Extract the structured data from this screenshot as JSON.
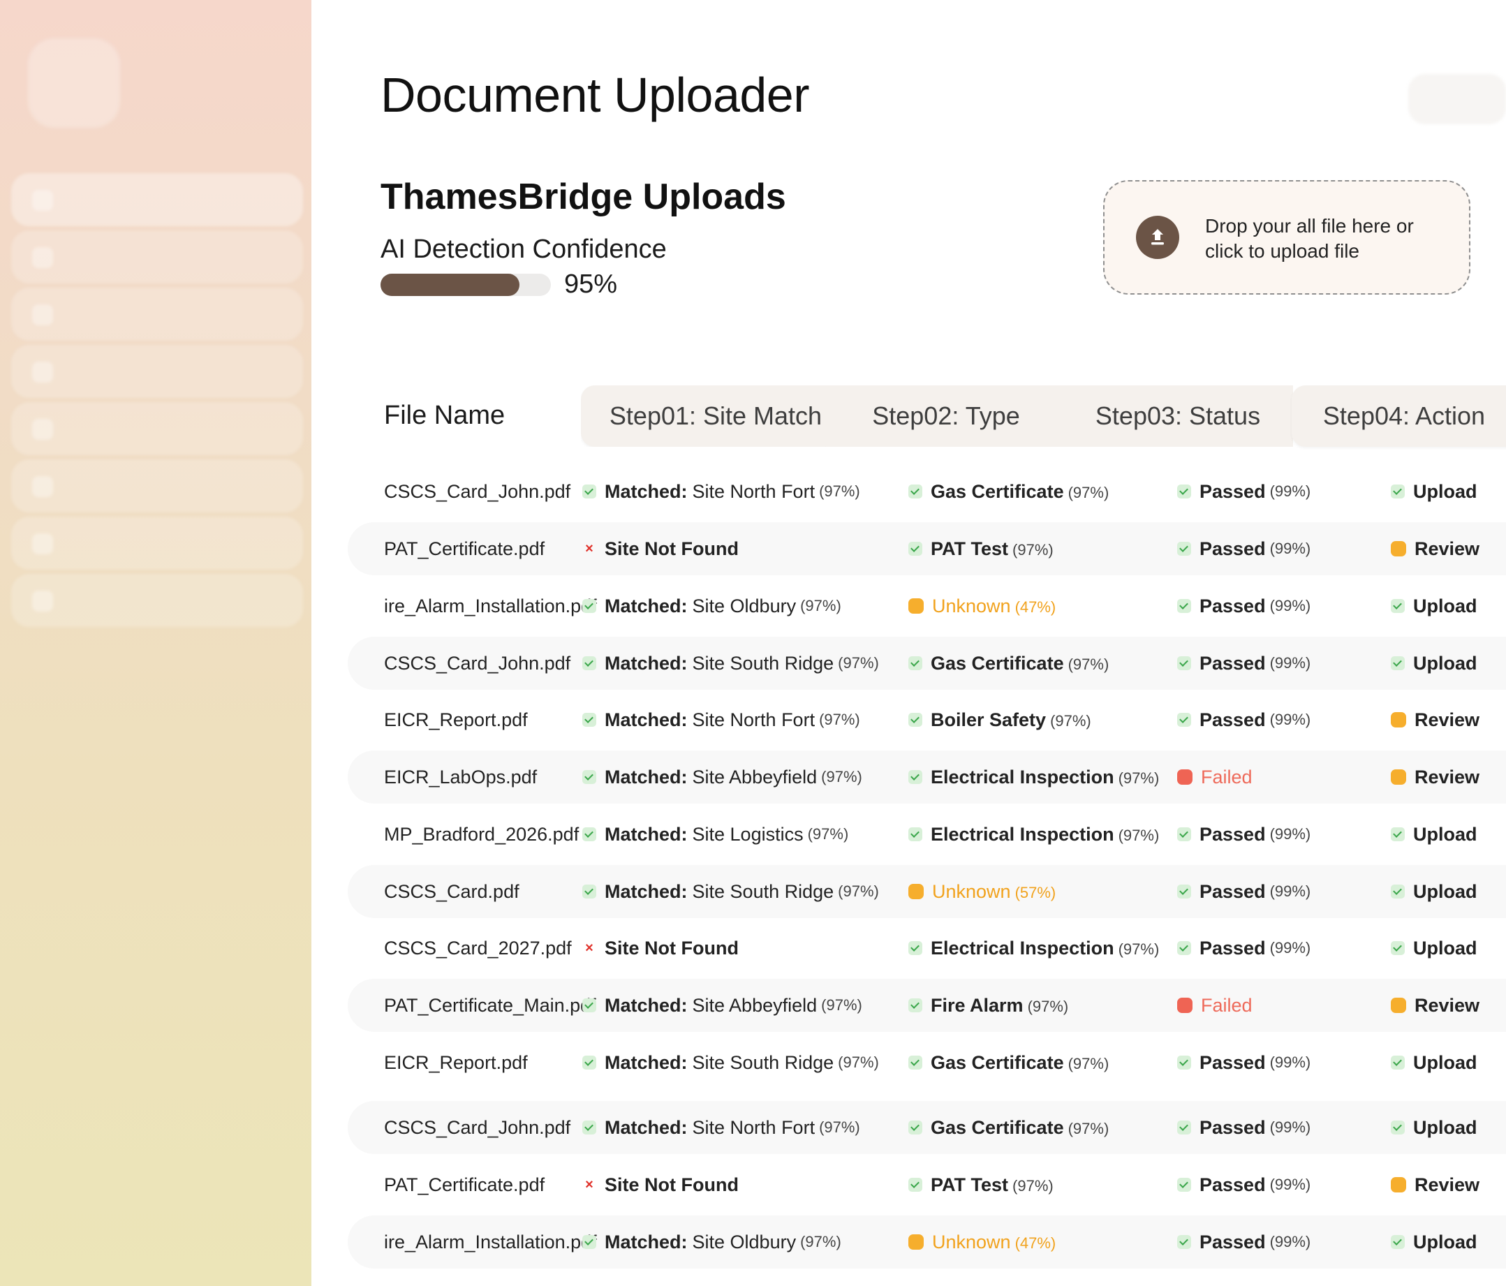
{
  "page_title": "Document Uploader",
  "section_title": "ThamesBridge Uploads",
  "confidence": {
    "label": "AI Detection Confidence",
    "value_text": "95%",
    "value": 0.95
  },
  "dropzone": {
    "line1": "Drop your all file here or",
    "line2": "click to upload file",
    "icon": "upload-icon"
  },
  "table": {
    "file_header": "File Name",
    "steps": [
      "Step01: Site Match",
      "Step02: Type",
      "Step03:  Status",
      "Step04: Action"
    ],
    "rows": [
      {
        "file": "CSCS_Card_John.pdf",
        "site_state": "ok",
        "site_prefix": "Matched:",
        "site": "Site North Fort",
        "site_pct": "(97%)",
        "type_state": "ok",
        "type": "Gas Certificate",
        "type_pct": "(97%)",
        "status_state": "ok",
        "status": "Passed",
        "status_pct": "(99%)",
        "action_state": "ok",
        "action": "Upload"
      },
      {
        "file": "PAT_Certificate.pdf",
        "site_state": "x",
        "site_prefix": "",
        "site": "Site Not Found",
        "site_pct": "",
        "type_state": "ok",
        "type": "PAT Test",
        "type_pct": "(97%)",
        "status_state": "ok",
        "status": "Passed",
        "status_pct": "(99%)",
        "action_state": "warn",
        "action": "Review"
      },
      {
        "file": "ire_Alarm_Installation.pdf",
        "site_state": "ok",
        "site_prefix": "Matched:",
        "site": "Site Oldbury",
        "site_pct": "(97%)",
        "type_state": "warn",
        "type": "Unknown",
        "type_pct": "(47%)",
        "status_state": "ok",
        "status": "Passed",
        "status_pct": "(99%)",
        "action_state": "ok",
        "action": "Upload"
      },
      {
        "file": "CSCS_Card_John.pdf",
        "site_state": "ok",
        "site_prefix": "Matched:",
        "site": "Site South Ridge",
        "site_pct": "(97%)",
        "type_state": "ok",
        "type": "Gas Certificate",
        "type_pct": "(97%)",
        "status_state": "ok",
        "status": "Passed",
        "status_pct": "(99%)",
        "action_state": "ok",
        "action": "Upload"
      },
      {
        "file": "EICR_Report.pdf",
        "site_state": "ok",
        "site_prefix": "Matched:",
        "site": "Site North Fort",
        "site_pct": "(97%)",
        "type_state": "ok",
        "type": "Boiler Safety",
        "type_pct": "(97%)",
        "status_state": "ok",
        "status": "Passed",
        "status_pct": "(99%)",
        "action_state": "warn",
        "action": "Review"
      },
      {
        "file": "EICR_LabOps.pdf",
        "site_state": "ok",
        "site_prefix": "Matched:",
        "site": "Site Abbeyfield",
        "site_pct": "(97%)",
        "type_state": "ok",
        "type": "Electrical Inspection",
        "type_pct": "(97%)",
        "status_state": "fail",
        "status": "Failed",
        "status_pct": "",
        "action_state": "warn",
        "action": "Review"
      },
      {
        "file": "MP_Bradford_2026.pdf",
        "site_state": "ok",
        "site_prefix": "Matched:",
        "site": "Site Logistics",
        "site_pct": "(97%)",
        "type_state": "ok",
        "type": "Electrical Inspection",
        "type_pct": "(97%)",
        "status_state": "ok",
        "status": "Passed",
        "status_pct": "(99%)",
        "action_state": "ok",
        "action": "Upload"
      },
      {
        "file": "CSCS_Card.pdf",
        "site_state": "ok",
        "site_prefix": "Matched:",
        "site": "Site South Ridge",
        "site_pct": "(97%)",
        "type_state": "warn",
        "type": "Unknown",
        "type_pct": "(57%)",
        "status_state": "ok",
        "status": "Passed",
        "status_pct": "(99%)",
        "action_state": "ok",
        "action": "Upload"
      },
      {
        "file": "CSCS_Card_2027.pdf",
        "site_state": "x",
        "site_prefix": "",
        "site": "Site Not Found",
        "site_pct": "",
        "type_state": "ok",
        "type": "Electrical Inspection",
        "type_pct": "(97%)",
        "status_state": "ok",
        "status": "Passed",
        "status_pct": "(99%)",
        "action_state": "ok",
        "action": "Upload"
      },
      {
        "file": "PAT_Certificate_Main.pdf",
        "site_state": "ok",
        "site_prefix": "Matched:",
        "site": "Site Abbeyfield",
        "site_pct": "(97%)",
        "type_state": "ok",
        "type": "Fire Alarm",
        "type_pct": "(97%)",
        "status_state": "fail",
        "status": "Failed",
        "status_pct": "",
        "action_state": "warn",
        "action": "Review"
      },
      {
        "file": "EICR_Report.pdf",
        "site_state": "ok",
        "site_prefix": "Matched:",
        "site": "Site South Ridge",
        "site_pct": "(97%)",
        "type_state": "ok",
        "type": "Gas Certificate",
        "type_pct": "(97%)",
        "status_state": "ok",
        "status": "Passed",
        "status_pct": "(99%)",
        "action_state": "ok",
        "action": "Upload"
      },
      {
        "file": "CSCS_Card_John.pdf",
        "site_state": "ok",
        "site_prefix": "Matched:",
        "site": "Site North Fort",
        "site_pct": "(97%)",
        "type_state": "ok",
        "type": "Gas Certificate",
        "type_pct": "(97%)",
        "status_state": "ok",
        "status": "Passed",
        "status_pct": "(99%)",
        "action_state": "ok",
        "action": "Upload"
      },
      {
        "file": "PAT_Certificate.pdf",
        "site_state": "x",
        "site_prefix": "",
        "site": "Site Not Found",
        "site_pct": "",
        "type_state": "ok",
        "type": "PAT Test",
        "type_pct": "(97%)",
        "status_state": "ok",
        "status": "Passed",
        "status_pct": "(99%)",
        "action_state": "warn",
        "action": "Review"
      },
      {
        "file": "ire_Alarm_Installation.pdf",
        "site_state": "ok",
        "site_prefix": "Matched:",
        "site": "Site Oldbury",
        "site_pct": "(97%)",
        "type_state": "warn",
        "type": "Unknown",
        "type_pct": "(47%)",
        "status_state": "ok",
        "status": "Passed",
        "status_pct": "(99%)",
        "action_state": "ok",
        "action": "Upload"
      }
    ]
  }
}
